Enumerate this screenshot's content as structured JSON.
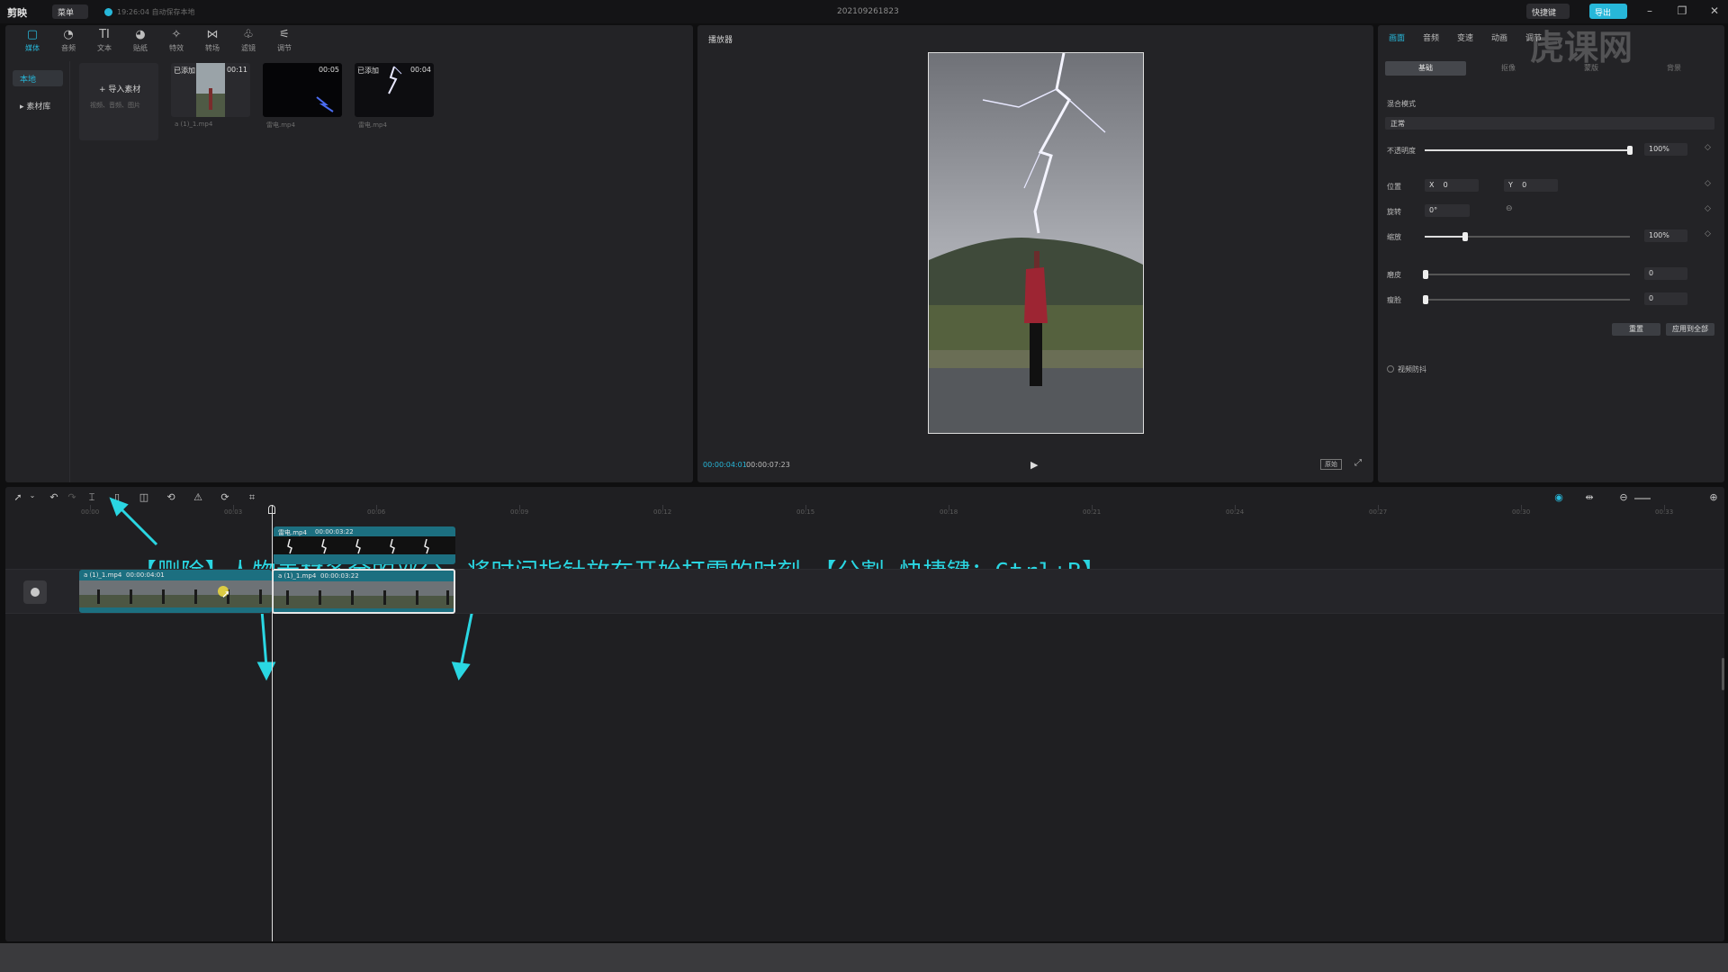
{
  "titlebar": {
    "app_name": "剪映",
    "menu_label": "菜单",
    "sync_text": "19:26:04 自动保存本地",
    "project_title": "202109261823",
    "shortcut_label": "快捷键",
    "export_label": "导出"
  },
  "media": {
    "tools": [
      {
        "icon": "media-icon",
        "glyph": "▢",
        "label": "媒体"
      },
      {
        "icon": "audio-icon",
        "glyph": "◔",
        "label": "音频"
      },
      {
        "icon": "text-icon",
        "glyph": "TI",
        "label": "文本"
      },
      {
        "icon": "sticker-icon",
        "glyph": "◕",
        "label": "贴纸"
      },
      {
        "icon": "effects-icon",
        "glyph": "✧",
        "label": "特效"
      },
      {
        "icon": "transition-icon",
        "glyph": "⋈",
        "label": "转场"
      },
      {
        "icon": "filter-icon",
        "glyph": "♧",
        "label": "滤镜"
      },
      {
        "icon": "adjust-icon",
        "glyph": "⚟",
        "label": "调节"
      }
    ],
    "sidebar": [
      {
        "label": "本地"
      },
      {
        "label": "▸ 素材库"
      }
    ],
    "import": {
      "label": "+ 导入素材",
      "hint": "视频、音频、图片"
    },
    "clips": [
      {
        "badge": "已添加",
        "duration": "00:11",
        "name": "a (1)_1.mp4"
      },
      {
        "badge": "",
        "duration": "00:05",
        "name": "雷电.mp4"
      },
      {
        "badge": "已添加",
        "duration": "00:04",
        "name": "雷电.mp4"
      }
    ]
  },
  "player": {
    "title": "播放器",
    "current_time": "00:00:04:01",
    "total_time": "00:00:07:23",
    "ratio_label": "原始"
  },
  "properties": {
    "tabs": [
      "画面",
      "音频",
      "变速",
      "动画",
      "调节"
    ],
    "subtabs": [
      "基础",
      "抠像",
      "蒙版",
      "背景"
    ],
    "blend_label": "混合模式",
    "blend_value": "正常",
    "opacity_label": "不透明度",
    "opacity_value": "100%",
    "opacity_level": 1.0,
    "position_label": "位置",
    "pos_x_label": "X",
    "pos_x": "0",
    "pos_y_label": "Y",
    "pos_y": "0",
    "rotate_label": "旋转",
    "rotate_value": "0°",
    "scale_label": "缩放",
    "scale_value": "100%",
    "sharpen_label": "磨皮",
    "sharpen_value": "0",
    "thin_label": "瘦脸",
    "thin_value": "0",
    "reset_label": "重置",
    "apply_all_label": "应用到全部",
    "stabilize_label": "视频防抖"
  },
  "timeline": {
    "ruler": [
      "00:00",
      "00:03",
      "00:06",
      "00:09",
      "00:12",
      "00:15",
      "00:18",
      "00:21",
      "00:24",
      "00:27",
      "00:30",
      "00:33"
    ],
    "annotation": "【删除】人物素材多余的部分，将时间指针放在开始打雷的时刻，【分割 快捷键：Ctrl+B】",
    "overlay_clip": {
      "name": "雷电.mp4",
      "duration": "00:00:03:22"
    },
    "main_clip_a": {
      "name": "a (1)_1.mp4",
      "duration": "00:00:04:01"
    },
    "main_clip_b": {
      "name": "a (1)_1.mp4",
      "duration": "00:00:03:22"
    }
  },
  "watermark": "虎课网",
  "colors": {
    "accent": "#27b7d9",
    "annotation": "#2ad6e2",
    "clip": "#1c6f80"
  }
}
